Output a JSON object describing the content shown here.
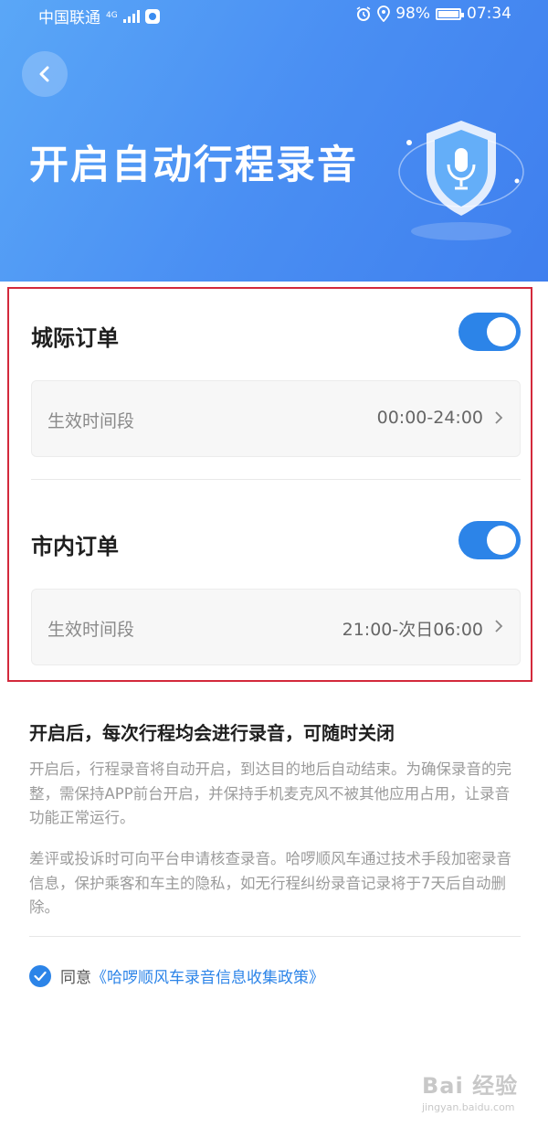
{
  "status_bar": {
    "carrier": "中国联通",
    "network": "4G",
    "battery": "98%",
    "time": "07:34"
  },
  "header": {
    "title": "开启自动行程录音"
  },
  "sections": [
    {
      "title": "城际订单",
      "enabled": true,
      "row_label": "生效时间段",
      "row_value": "00:00-24:00"
    },
    {
      "title": "市内订单",
      "enabled": true,
      "row_label": "生效时间段",
      "row_value": "21:00-次日06:00"
    }
  ],
  "info": {
    "title": "开启后，每次行程均会进行录音，可随时关闭",
    "para1": "开启后，行程录音将自动开启，到达目的地后自动结束。为确保录音的完整，需保持APP前台开启，并保持手机麦克风不被其他应用占用，让录音功能正常运行。",
    "para2": "差评或投诉时可向平台申请核查录音。哈啰顺风车通过技术手段加密录音信息，保护乘客和车主的隐私，如无行程纠纷录音记录将于7天后自动删除。"
  },
  "agreement": {
    "checked": true,
    "label": "同意",
    "link": "《哈啰顺风车录音信息收集政策》"
  },
  "watermark": {
    "text": "Bai 经验",
    "url": "jingyan.baidu.com"
  },
  "colors": {
    "accent": "#2c84e8",
    "header_gradient_start": "#5aa7f7",
    "header_gradient_end": "#3f7fee",
    "highlight_border": "#d3293c"
  },
  "icons": [
    "back-arrow-icon",
    "shield-microphone-icon",
    "chevron-right-icon",
    "checkmark-icon",
    "alarm-icon",
    "location-icon",
    "battery-icon",
    "signal-icon"
  ]
}
